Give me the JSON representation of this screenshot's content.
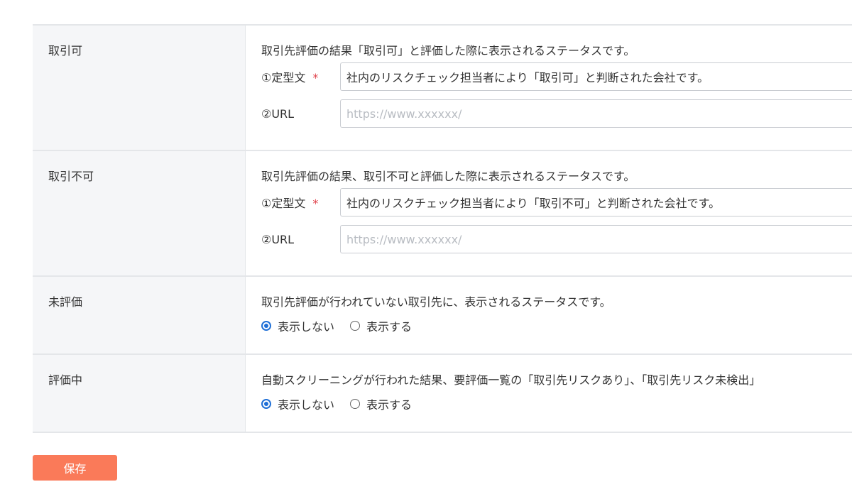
{
  "rows": [
    {
      "label": "取引可",
      "description": "取引先評価の結果「取引可」と評価した際に表示されるステータスです。",
      "template_label": "①定型文",
      "required_mark": "*",
      "template_value": "社内のリスクチェック担当者により「取引可」と判断された会社です。",
      "url_label": "②URL",
      "url_placeholder": "https://www.xxxxxx/"
    },
    {
      "label": "取引不可",
      "description": "取引先評価の結果、取引不可と評価した際に表示されるステータスです。",
      "template_label": "①定型文",
      "required_mark": "*",
      "template_value": "社内のリスクチェック担当者により「取引不可」と判断された会社です。",
      "url_label": "②URL",
      "url_placeholder": "https://www.xxxxxx/"
    },
    {
      "label": "未評価",
      "description": "取引先評価が行われていない取引先に、表示されるステータスです。",
      "radio_hide": "表示しない",
      "radio_show": "表示する",
      "selected": "hide"
    },
    {
      "label": "評価中",
      "description": "自動スクリーニングが行われた結果、要評価一覧の「取引先リスクあり」、「取引先リスク未検出」",
      "radio_hide": "表示しない",
      "radio_show": "表示する",
      "selected": "hide"
    }
  ],
  "save_label": "保存",
  "colors": {
    "accent": "#fa7a59",
    "radio_selected": "#1f6fd6",
    "required": "#e0424b",
    "label_bg": "#f5f6f8"
  }
}
